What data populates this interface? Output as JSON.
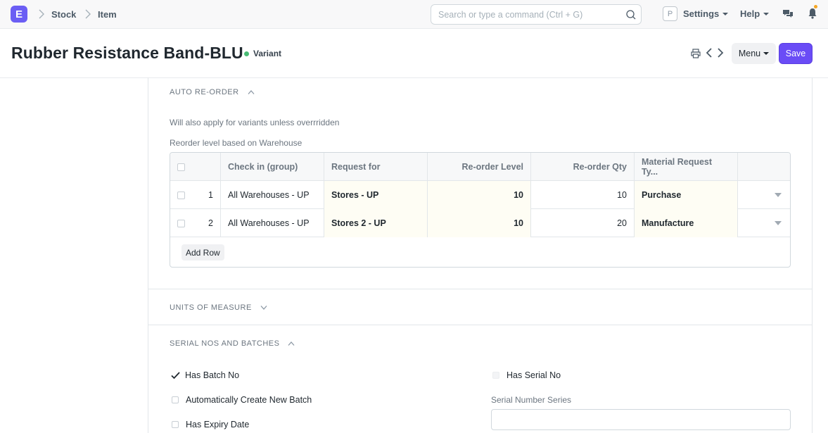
{
  "navbar": {
    "logo_letter": "E",
    "breadcrumbs": [
      "Stock",
      "Item"
    ],
    "search_placeholder": "Search or type a command (Ctrl + G)",
    "avatar_letter": "P",
    "settings_label": "Settings",
    "help_label": "Help"
  },
  "header": {
    "title": "Rubber Resistance Band-BLU",
    "status": "Variant",
    "menu_label": "Menu",
    "save_label": "Save"
  },
  "auto_reorder": {
    "section_label": "AUTO RE-ORDER",
    "help_text": "Will also apply for variants unless overrridden",
    "table_label": "Reorder level based on Warehouse",
    "columns": [
      "Check in (group)",
      "Request for",
      "Re-order Level",
      "Re-order Qty",
      "Material Request Ty..."
    ],
    "rows": [
      {
        "idx": "1",
        "group": "All Warehouses - UP",
        "request_for": "Stores - UP",
        "level": "10",
        "qty": "10",
        "type": "Purchase"
      },
      {
        "idx": "2",
        "group": "All Warehouses - UP",
        "request_for": "Stores 2 - UP",
        "level": "10",
        "qty": "20",
        "type": "Manufacture"
      }
    ],
    "add_row_label": "Add Row"
  },
  "units_of_measure": {
    "section_label": "UNITS OF MEASURE"
  },
  "serial_batches": {
    "section_label": "SERIAL NOS AND BATCHES",
    "has_batch_no": "Has Batch No",
    "auto_create_batch": "Automatically Create New Batch",
    "has_expiry_date": "Has Expiry Date",
    "has_serial_no": "Has Serial No",
    "serial_series_label": "Serial Number Series",
    "serial_series_value": ""
  },
  "colors": {
    "primary": "#6a4cf6",
    "status_dot": "#48bb74",
    "notification_dot": "#f5a623"
  }
}
